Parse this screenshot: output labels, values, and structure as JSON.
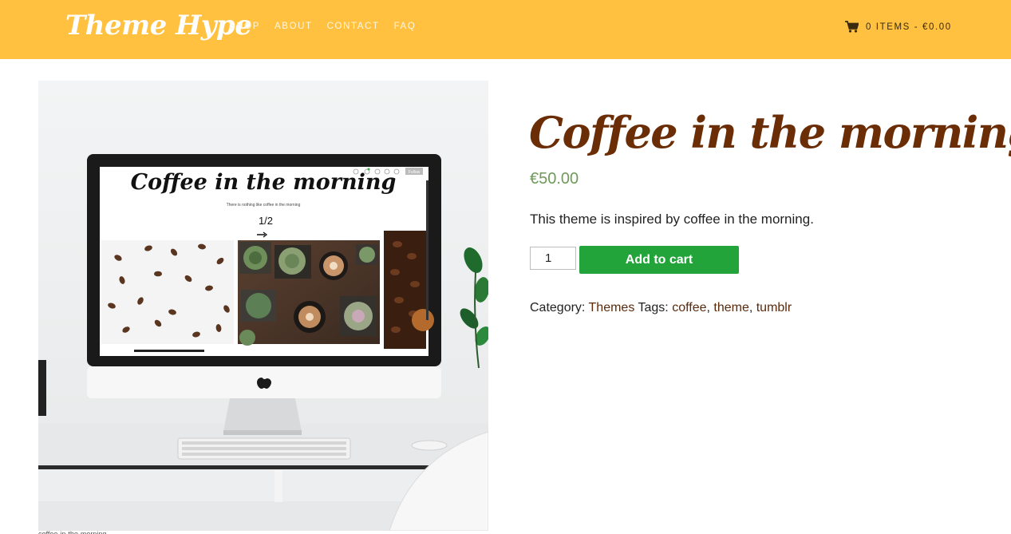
{
  "header": {
    "logo": "Theme Hype",
    "nav": [
      "SHOP",
      "ABOUT",
      "CONTACT",
      "FAQ"
    ],
    "cart_label": "0 ITEMS - €0.00",
    "background_color": "#ffc13f"
  },
  "product": {
    "title": "Coffee in the morning",
    "price": "€50.00",
    "description": "This theme is inspired by coffee in the morning.",
    "quantity": "1",
    "add_to_cart_label": "Add to cart",
    "category_label": "Category:",
    "category": "Themes",
    "tags_label": "Tags:",
    "tags": [
      "coffee",
      "theme",
      "tumblr"
    ],
    "title_color": "#6b2d06",
    "price_color": "#6f9a5b",
    "button_color": "#22a43a"
  },
  "screen_preview": {
    "title": "Coffee in the morning",
    "subtitle": "There is nothing like coffee in the morning",
    "pager": "1/2",
    "follow_label": "Follow"
  },
  "image_caption": "coffee-in-the-morning"
}
